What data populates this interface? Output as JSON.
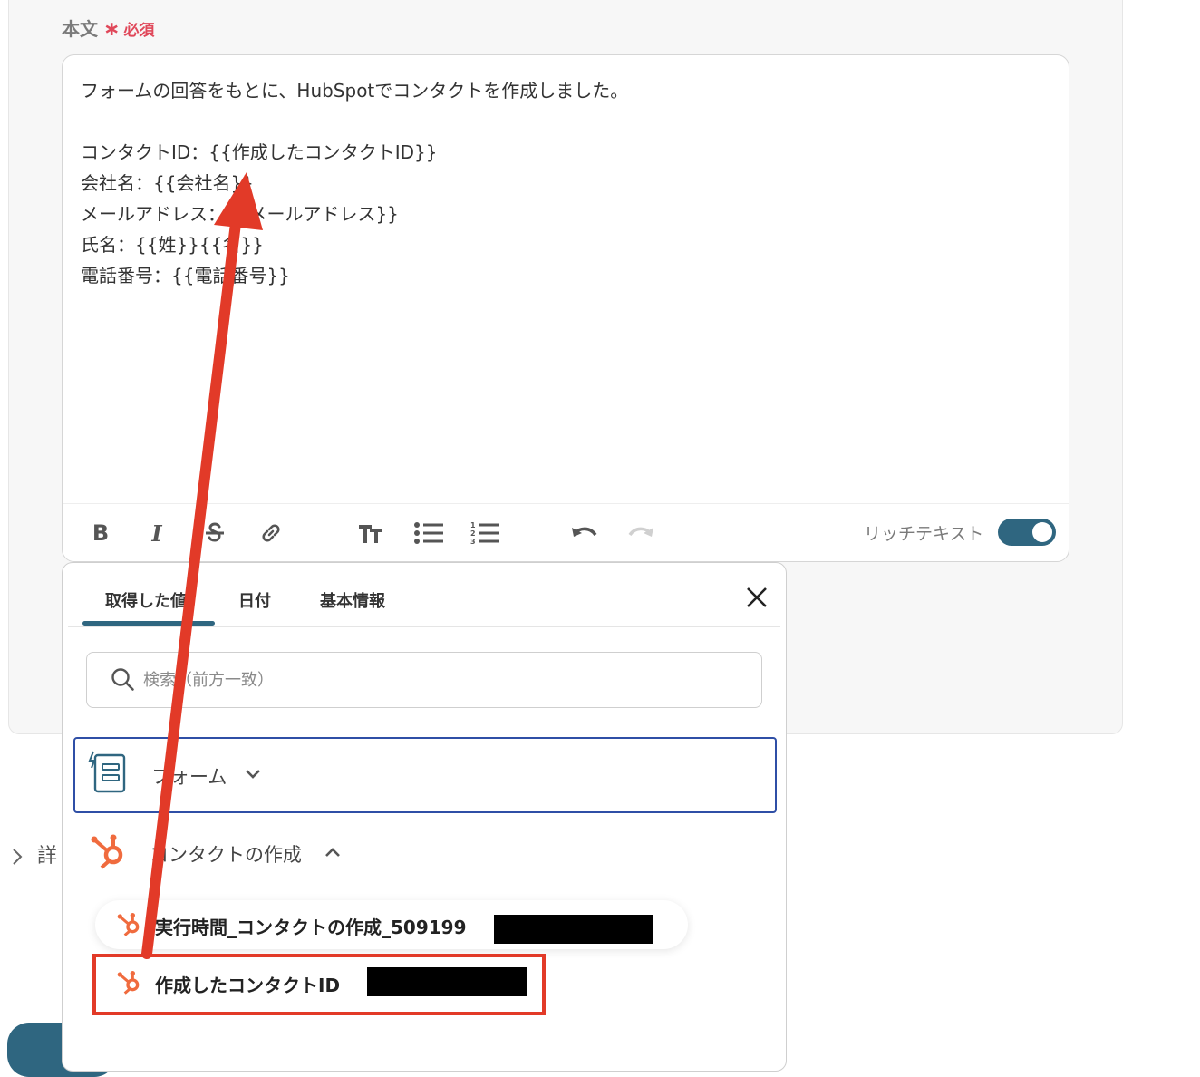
{
  "field": {
    "label": "本文",
    "required_mark": "∗",
    "required_text": "必須"
  },
  "editor": {
    "body": "フォームの回答をもとに、HubSpotでコンタクトを作成しました。\n\nコンタクトID：{{作成したコンタクトID}}\n会社名：{{会社名}}\nメールアドレス：{{メールアドレス}}\n氏名：{{姓}}{{名}}\n電話番号：{{電話番号}}",
    "toolbar": {
      "bold": "B",
      "italic": "I",
      "rich_text_label": "リッチテキスト",
      "rich_text_enabled": true
    }
  },
  "detail": {
    "label": "詳"
  },
  "panel": {
    "tabs": [
      {
        "label": "取得した値",
        "active": true
      },
      {
        "label": "日付",
        "active": false
      },
      {
        "label": "基本情報",
        "active": false
      }
    ],
    "search": {
      "placeholder": "検索（前方一致）",
      "value": ""
    },
    "groups": [
      {
        "label": "フォーム",
        "icon": "form-icon",
        "expanded": false
      },
      {
        "label": "コンタクトの作成",
        "icon": "hubspot-icon",
        "expanded": true
      }
    ],
    "items": [
      {
        "label": "実行時間_コンタクトの作成_509199",
        "icon": "hubspot-icon"
      },
      {
        "label": "作成したコンタクトID",
        "icon": "hubspot-icon"
      }
    ]
  },
  "colors": {
    "accent": "#2f6680",
    "required": "#e0485a",
    "annotation": "#e23a28",
    "hubspot": "#f06b3e",
    "focus_border": "#2f4fa6"
  }
}
